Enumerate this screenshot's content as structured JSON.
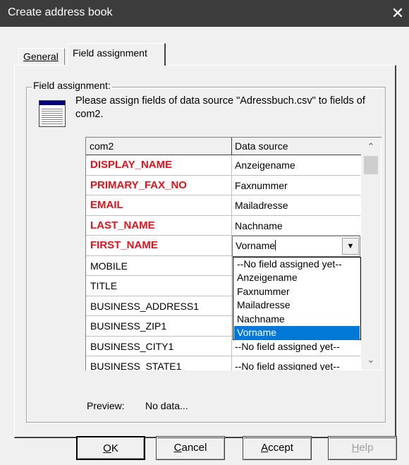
{
  "window": {
    "title": "Create address book",
    "close_glyph": "✕"
  },
  "tabs": [
    {
      "label": "General",
      "active": false
    },
    {
      "label": "Field assignment",
      "active": true
    }
  ],
  "group": {
    "title": "Field assignment:",
    "instruction": "Please assign fields of data source \"Adressbuch.csv\" to fields of com2.",
    "icon": "table-icon"
  },
  "grid": {
    "columns": [
      "com2",
      "Data source"
    ],
    "rows": [
      {
        "field": "DISPLAY_NAME",
        "required": true,
        "source": "Anzeigename"
      },
      {
        "field": "PRIMARY_FAX_NO",
        "required": true,
        "source": "Faxnummer"
      },
      {
        "field": "EMAIL",
        "required": true,
        "source": "Mailadresse"
      },
      {
        "field": "LAST_NAME",
        "required": true,
        "source": "Nachname"
      },
      {
        "field": "FIRST_NAME",
        "required": true,
        "source": "Vorname"
      },
      {
        "field": "MOBILE",
        "required": false,
        "source": ""
      },
      {
        "field": "TITLE",
        "required": false,
        "source": ""
      },
      {
        "field": "BUSINESS_ADDRESS1",
        "required": false,
        "source": ""
      },
      {
        "field": "BUSINESS_ZIP1",
        "required": false,
        "source": ""
      },
      {
        "field": "BUSINESS_CITY1",
        "required": false,
        "source": "--No field assigned yet--"
      },
      {
        "field": "BUSINESS_STATE1",
        "required": false,
        "source": "--No field assigned yet--"
      }
    ],
    "required_color": "#e2131b"
  },
  "combo": {
    "value": "Vorname",
    "options": [
      "--No field assigned yet--",
      "Anzeigename",
      "Faxnummer",
      "Mailadresse",
      "Nachname",
      "Vorname"
    ],
    "selected_index": 5,
    "highlight_color": "#0078d7"
  },
  "preview": {
    "label": "Preview:",
    "value": "No data..."
  },
  "buttons": {
    "ok": {
      "mnemonic": "O",
      "rest": "K"
    },
    "cancel": {
      "mnemonic": "C",
      "rest": "ancel"
    },
    "accept": {
      "mnemonic": "A",
      "rest": "ccept"
    },
    "help": {
      "mnemonic": "H",
      "rest": "elp",
      "disabled": true
    }
  }
}
